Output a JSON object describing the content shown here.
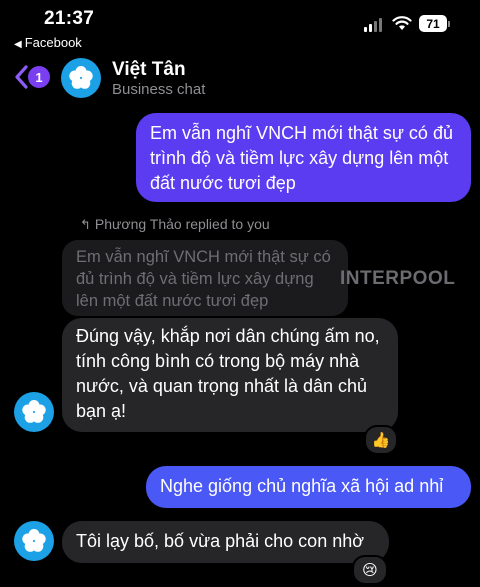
{
  "status_bar": {
    "time": "21:37",
    "battery": "71",
    "back_app": "Facebook"
  },
  "header": {
    "unread_count": "1",
    "name": "Việt Tân",
    "subtitle": "Business chat"
  },
  "messages": [
    {
      "side": "out",
      "text": "Em vẫn nghĩ VNCH mới thật sự có đủ trình độ và tiềm lực xây dựng lên một đất nước tươi đẹp"
    },
    {
      "side": "in",
      "reply_label": "Phương Thảo replied to you",
      "quoted": "Em vẫn nghĩ VNCH mới thật sự có đủ trình độ và tiềm lực xây dựng lên một đất nước tươi đẹp",
      "text": "Đúng vậy, khắp nơi dân chúng ấm no, tính công bình có trong bộ máy nhà nước, và quan trọng nhất là dân chủ bạn ạ!",
      "reaction": "👍"
    },
    {
      "side": "out",
      "text": "Nghe giống chủ nghĩa xã hội ad nhỉ"
    },
    {
      "side": "in",
      "text": "Tôi lạy bố, bố vừa phải cho con nhờ",
      "reaction": "😢"
    }
  ],
  "watermark": "INTERPOOL",
  "colors": {
    "outgoing": "#5b3cf0",
    "outgoing_alt": "#4a58f5",
    "incoming": "#262629",
    "avatar": "#1da1e6",
    "badge": "#7b3ff2"
  },
  "icons": {
    "back": "chevron-left-icon",
    "avatar": "flower-icon",
    "reply": "reply-arrow-icon"
  }
}
